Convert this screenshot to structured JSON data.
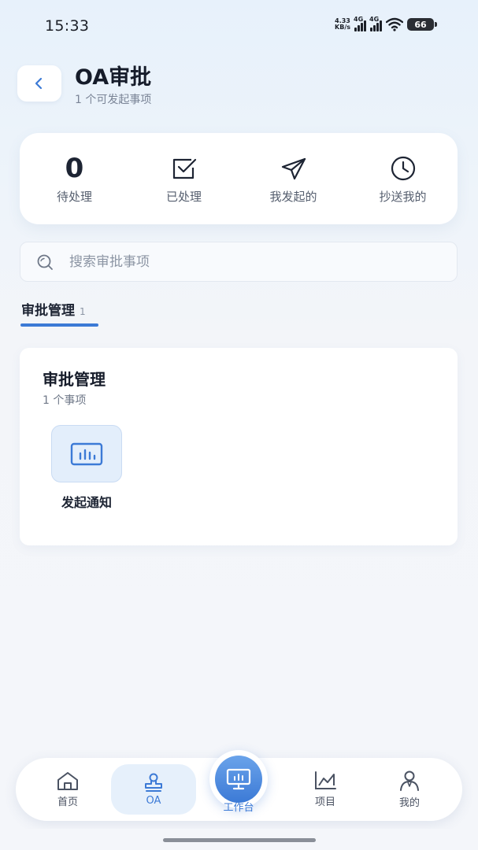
{
  "status_bar": {
    "time": "15:33",
    "net_speed_value": "4.33",
    "net_speed_unit": "KB/s",
    "sim1": "4G",
    "sim2": "4G",
    "battery": "66"
  },
  "header": {
    "title": "OA审批",
    "subtitle": "1 个可发起事项"
  },
  "stats": [
    {
      "label": "待处理",
      "value": "0"
    },
    {
      "label": "已处理",
      "icon": "check-square-icon"
    },
    {
      "label": "我发起的",
      "icon": "send-icon"
    },
    {
      "label": "抄送我的",
      "icon": "clock-icon"
    }
  ],
  "search": {
    "placeholder": "搜索审批事项"
  },
  "tabs": [
    {
      "label": "审批管理",
      "count": "1",
      "active": true
    }
  ],
  "group": {
    "title": "审批管理",
    "count_text": "1 个事项",
    "apps": [
      {
        "label": "发起通知",
        "icon": "chart-board-icon"
      }
    ]
  },
  "bottom_nav": {
    "items": [
      {
        "label": "首页",
        "icon": "home-icon"
      },
      {
        "label": "OA",
        "icon": "stamp-icon",
        "active": true
      },
      {
        "label": "工作台",
        "icon": "monitor-icon"
      },
      {
        "label": "项目",
        "icon": "line-chart-icon"
      },
      {
        "label": "我的",
        "icon": "user-icon"
      }
    ]
  },
  "colors": {
    "accent": "#3c7ad6",
    "active_bg": "#e6f0fb",
    "text_primary": "#1d2433",
    "text_secondary": "#7a8496"
  }
}
